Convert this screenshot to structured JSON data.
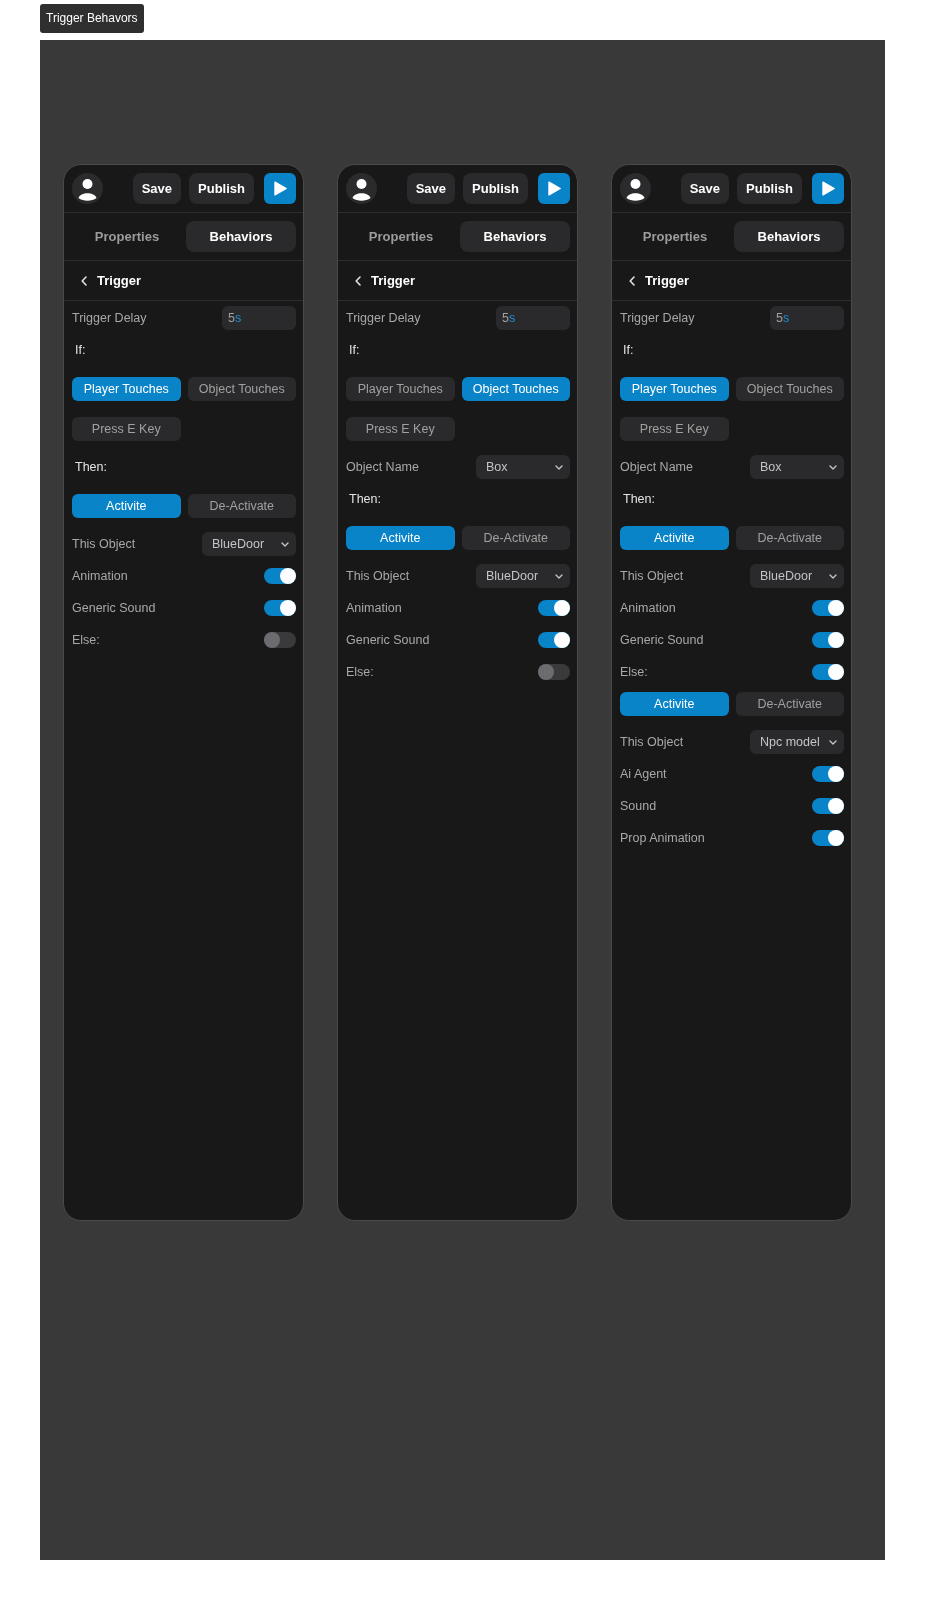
{
  "frame": {
    "title": "Trigger Behavors"
  },
  "panels": [
    {
      "toolbar": {
        "buttons": [
          {
            "label": "Save"
          },
          {
            "label": "Publish"
          }
        ]
      },
      "tabs": [
        {
          "label": "Properties",
          "selected": false
        },
        {
          "label": "Behaviors",
          "selected": true
        }
      ],
      "breadcrumb": {
        "title": "Trigger"
      },
      "rows": [
        {
          "kind": "field",
          "label": "Trigger Delay",
          "value": "5",
          "unit": "s"
        },
        {
          "kind": "heading",
          "text": "If:"
        },
        {
          "kind": "choices",
          "options": [
            {
              "label": "Player Touches",
              "selected": true
            },
            {
              "label": "Object Touches",
              "selected": false
            },
            {
              "label": "Press E Key",
              "selected": false
            }
          ]
        },
        {
          "kind": "heading",
          "text": "Then:"
        },
        {
          "kind": "choices",
          "options": [
            {
              "label": "Activite",
              "selected": true
            },
            {
              "label": "De-Activate",
              "selected": false
            }
          ]
        },
        {
          "kind": "select",
          "label": "This Object",
          "value": "BlueDoor"
        },
        {
          "kind": "toggle",
          "label": "Animation",
          "on": true
        },
        {
          "kind": "toggle",
          "label": "Generic Sound",
          "on": true
        },
        {
          "kind": "toggle",
          "label": "Else:",
          "on": false
        }
      ]
    },
    {
      "toolbar": {
        "buttons": [
          {
            "label": "Save"
          },
          {
            "label": "Publish"
          }
        ]
      },
      "tabs": [
        {
          "label": "Properties",
          "selected": false
        },
        {
          "label": "Behaviors",
          "selected": true
        }
      ],
      "breadcrumb": {
        "title": "Trigger"
      },
      "rows": [
        {
          "kind": "field",
          "label": "Trigger Delay",
          "value": "5",
          "unit": "s"
        },
        {
          "kind": "heading",
          "text": "If:"
        },
        {
          "kind": "choices",
          "options": [
            {
              "label": "Player Touches",
              "selected": false
            },
            {
              "label": "Object Touches",
              "selected": true
            },
            {
              "label": "Press E Key",
              "selected": false
            }
          ]
        },
        {
          "kind": "select",
          "label": "Object Name",
          "value": "Box"
        },
        {
          "kind": "heading",
          "text": "Then:"
        },
        {
          "kind": "choices",
          "options": [
            {
              "label": "Activite",
              "selected": true
            },
            {
              "label": "De-Activate",
              "selected": false
            }
          ]
        },
        {
          "kind": "select",
          "label": "This Object",
          "value": "BlueDoor"
        },
        {
          "kind": "toggle",
          "label": "Animation",
          "on": true
        },
        {
          "kind": "toggle",
          "label": "Generic Sound",
          "on": true
        },
        {
          "kind": "toggle",
          "label": "Else:",
          "on": false
        }
      ]
    },
    {
      "toolbar": {
        "buttons": [
          {
            "label": "Save"
          },
          {
            "label": "Publish"
          }
        ]
      },
      "tabs": [
        {
          "label": "Properties",
          "selected": false
        },
        {
          "label": "Behaviors",
          "selected": true
        }
      ],
      "breadcrumb": {
        "title": "Trigger"
      },
      "rows": [
        {
          "kind": "field",
          "label": "Trigger Delay",
          "value": "5",
          "unit": "s"
        },
        {
          "kind": "heading",
          "text": "If:"
        },
        {
          "kind": "choices",
          "options": [
            {
              "label": "Player Touches",
              "selected": true
            },
            {
              "label": "Object Touches",
              "selected": false
            },
            {
              "label": "Press E Key",
              "selected": false
            }
          ]
        },
        {
          "kind": "select",
          "label": "Object Name",
          "value": "Box"
        },
        {
          "kind": "heading",
          "text": "Then:"
        },
        {
          "kind": "choices",
          "options": [
            {
              "label": "Activite",
              "selected": true
            },
            {
              "label": "De-Activate",
              "selected": false
            }
          ]
        },
        {
          "kind": "select",
          "label": "This Object",
          "value": "BlueDoor"
        },
        {
          "kind": "toggle",
          "label": "Animation",
          "on": true
        },
        {
          "kind": "toggle",
          "label": "Generic Sound",
          "on": true
        },
        {
          "kind": "toggle",
          "label": "Else:",
          "on": true
        },
        {
          "kind": "choices",
          "options": [
            {
              "label": "Activite",
              "selected": true
            },
            {
              "label": "De-Activate",
              "selected": false
            }
          ]
        },
        {
          "kind": "select",
          "label": "This Object",
          "value": "Npc model"
        },
        {
          "kind": "toggle",
          "label": "Ai Agent",
          "on": true
        },
        {
          "kind": "toggle",
          "label": "Sound",
          "on": true
        },
        {
          "kind": "toggle",
          "label": "Prop Animation",
          "on": true
        }
      ]
    }
  ]
}
